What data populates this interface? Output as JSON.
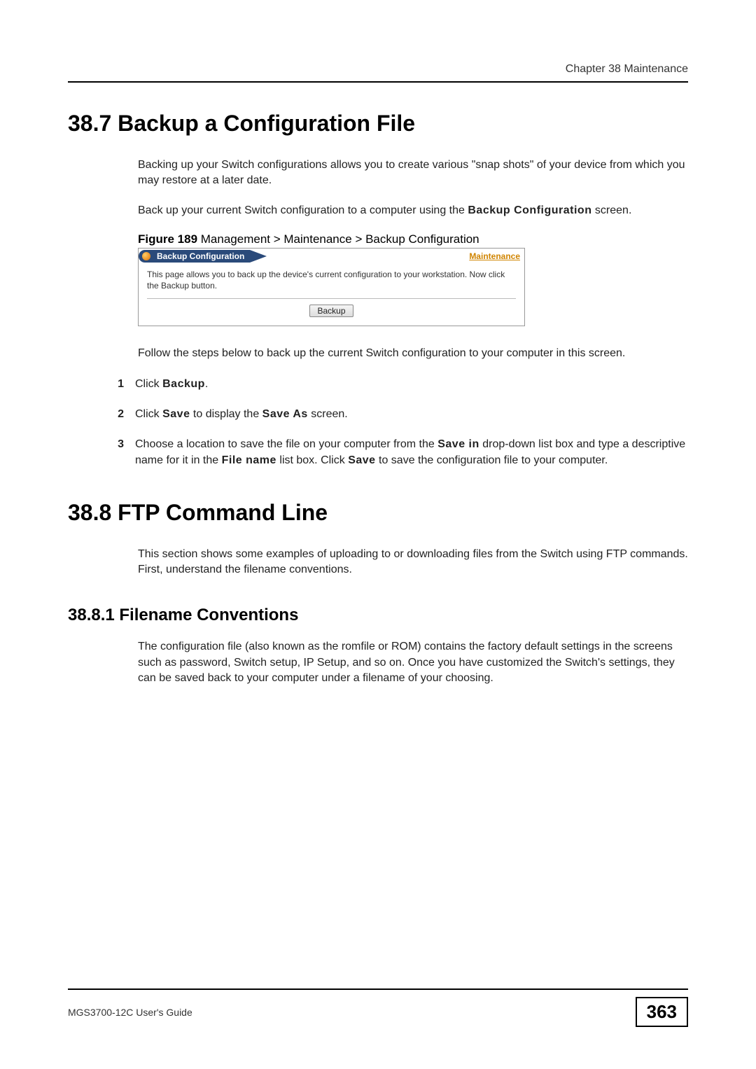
{
  "chapter_header": "Chapter 38 Maintenance",
  "section_38_7": {
    "heading": "38.7  Backup a Configuration File",
    "para1": "Backing up your Switch configurations allows you to create various \"snap shots\" of your device from which you may restore at a later date.",
    "para2_a": "Back up your current Switch configuration to a computer using the ",
    "para2_term1": "Backup Configuration",
    "para2_b": " screen.",
    "figure_label": "Figure 189",
    "figure_caption": "   Management > Maintenance > Backup Configuration",
    "screenshot": {
      "tab_title": "Backup Configuration",
      "maint_link": "Maintenance",
      "body_text": "This page allows you to back up the device's current configuration to your workstation. Now click the Backup button.",
      "backup_btn": "Backup"
    },
    "para3": "Follow the steps below to back up the current Switch configuration to your computer in this screen.",
    "steps": [
      {
        "num": "1",
        "a": "Click ",
        "t1": "Backup",
        "b": "."
      },
      {
        "num": "2",
        "a": "Click ",
        "t1": "Save",
        "b": " to display the ",
        "t2": "Save As",
        "c": " screen."
      },
      {
        "num": "3",
        "a": "Choose a location to save the file on your computer from the ",
        "t1": "Save in",
        "b": " drop-down list box and type a descriptive name for it in the ",
        "t2": "File name",
        "c": " list box. Click ",
        "t3": "Save",
        "d": " to save the configuration file to your computer."
      }
    ]
  },
  "section_38_8": {
    "heading": "38.8  FTP Command Line",
    "para1": "This section shows some examples of uploading to or downloading files from the Switch using FTP commands. First, understand the filename conventions.",
    "sub1_heading": "38.8.1  Filename Conventions",
    "sub1_para1": "The configuration file (also known as the romfile or ROM) contains the factory default settings in the screens such as password, Switch setup, IP Setup, and so on. Once you have customized the Switch's settings, they can be saved back to your computer under a filename of your choosing."
  },
  "footer": {
    "guide_name": "MGS3700-12C User's Guide",
    "page_number": "363"
  }
}
